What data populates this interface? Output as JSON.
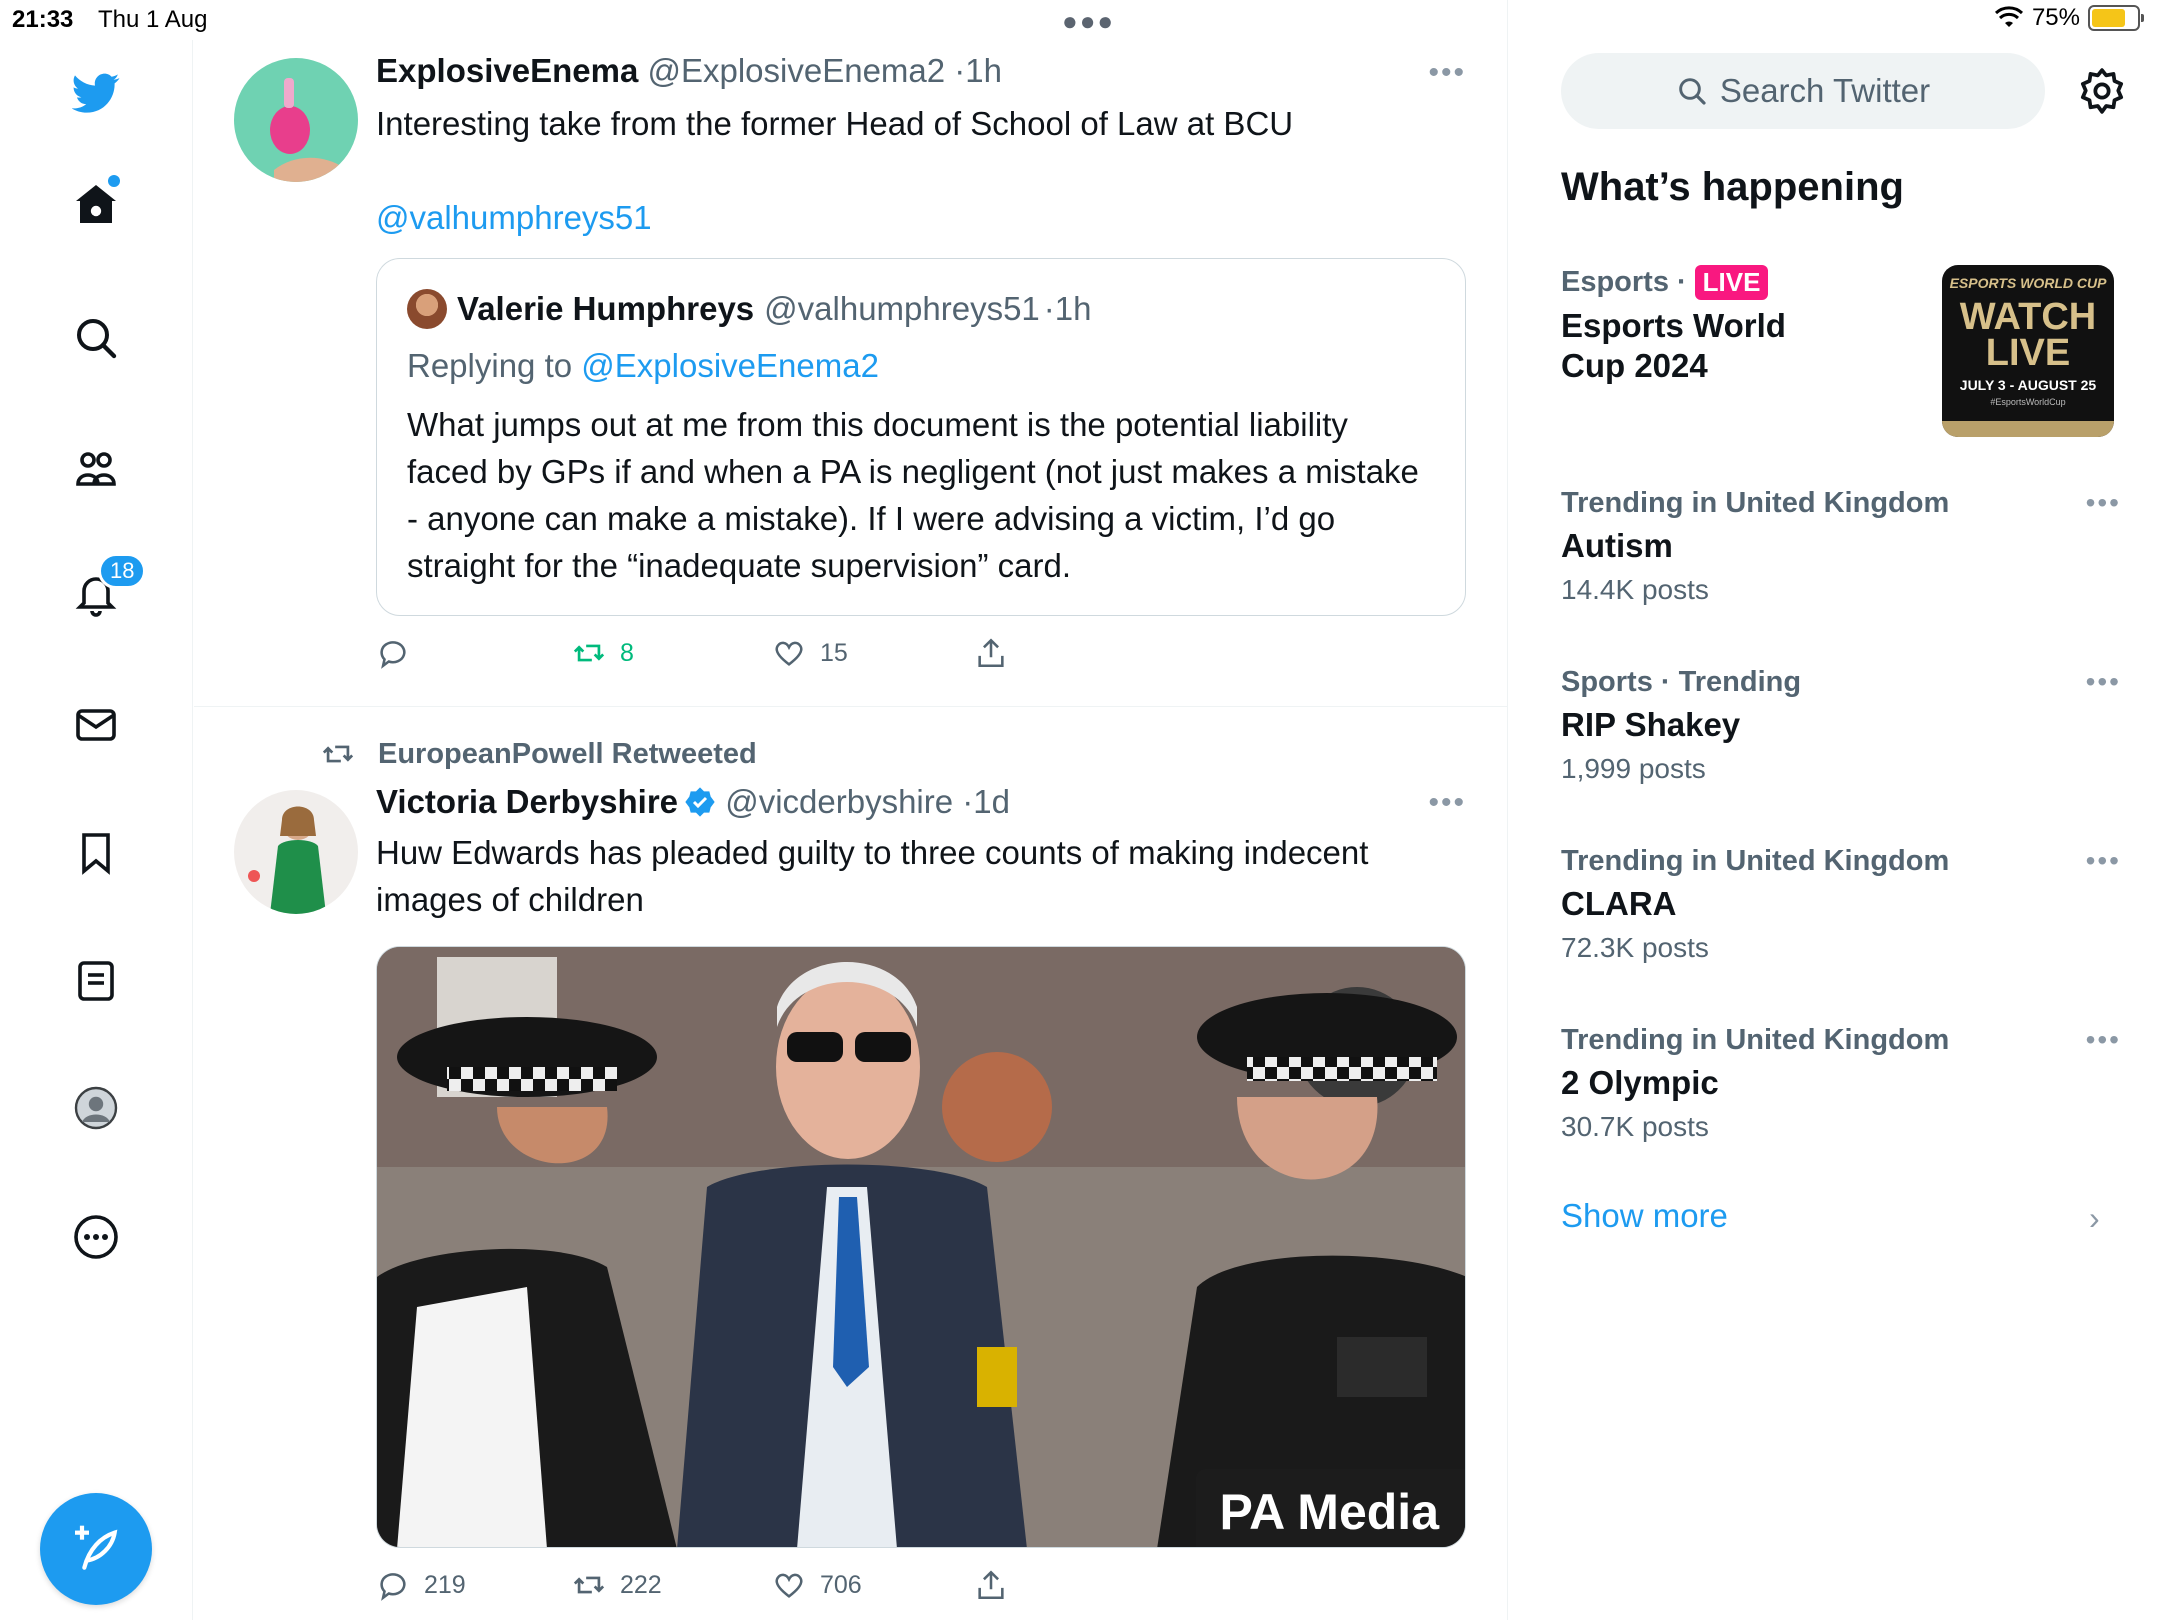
{
  "status": {
    "time": "21:33",
    "date": "Thu 1 Aug",
    "battery": "75%",
    "battery_level": 0.75
  },
  "nav": {
    "notifications_badge": "18"
  },
  "tweet1": {
    "name": "ExplosiveEnema",
    "handle": "@ExplosiveEnema2",
    "time": "1h",
    "text": "Interesting take from the former Head of School of Law at BCU",
    "mention": "@valhumphreys51",
    "quote": {
      "name": "Valerie Humphreys",
      "handle": "@valhumphreys51",
      "time": "1h",
      "replying_prefix": "Replying to",
      "replying_to": "@ExplosiveEnema2",
      "text": "What jumps out at me from this document is the potential liability faced by GPs if and when a PA is negligent (not just makes a mistake - anyone can make a mistake). If I were advising a victim, I’d go straight for the “inadequate supervision” card."
    },
    "retweets": "8",
    "likes": "15"
  },
  "tweet2": {
    "retweeted_by": "EuropeanPowell Retweeted",
    "name": "Victoria Derbyshire",
    "handle": "@vicderbyshire",
    "time": "1d",
    "text": "Huw Edwards has pleaded guilty to three counts of making indecent images of children",
    "media_credit": "PA Media",
    "replies": "219",
    "retweets": "222",
    "likes": "706"
  },
  "right": {
    "search_placeholder": "Search Twitter",
    "heading": "What’s happening",
    "esports": {
      "category": "Esports",
      "live": "LIVE",
      "title": "Esports World Cup 2024",
      "image_top": "ESPORTS WORLD CUP",
      "image_main": "WATCH LIVE",
      "image_dates": "JULY 3 - AUGUST 25",
      "image_tag": "#EsportsWorldCup"
    },
    "trends": [
      {
        "context": "Trending in United Kingdom",
        "title": "Autism",
        "count": "14.4K posts"
      },
      {
        "context": "Sports · Trending",
        "title": "RIP Shakey",
        "count": "1,999 posts"
      },
      {
        "context": "Trending in United Kingdom",
        "title": "CLARA",
        "count": "72.3K posts"
      },
      {
        "context": "Trending in United Kingdom",
        "title": "2 Olympic",
        "count": "30.7K posts"
      }
    ],
    "show_more": "Show more"
  },
  "colors": {
    "accent": "#1d9bf0",
    "retweet_green": "#00ba7c",
    "live_pink": "#f91880",
    "muted_text": "#536471"
  }
}
